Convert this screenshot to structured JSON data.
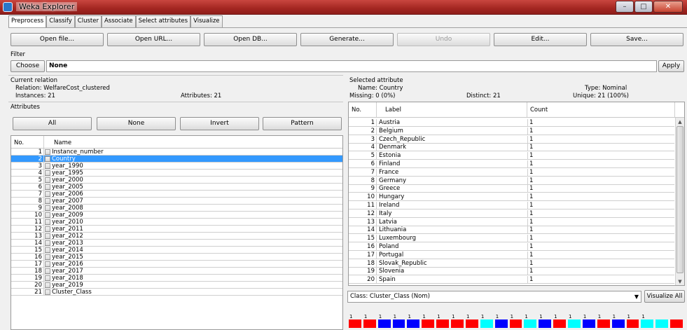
{
  "window": {
    "title": "Weka Explorer"
  },
  "tabs": [
    "Preprocess",
    "Classify",
    "Cluster",
    "Associate",
    "Select attributes",
    "Visualize"
  ],
  "toolbar": {
    "open_file": "Open file...",
    "open_url": "Open URL...",
    "open_db": "Open DB...",
    "generate": "Generate...",
    "undo": "Undo",
    "edit": "Edit...",
    "save": "Save..."
  },
  "filter": {
    "label": "Filter",
    "choose": "Choose",
    "value": "None",
    "apply": "Apply"
  },
  "current_relation": {
    "heading": "Current relation",
    "relation": "Relation: WelfareCost_clustered",
    "instances": "Instances: 21",
    "attributes": "Attributes: 21"
  },
  "attributes_panel": {
    "heading": "Attributes",
    "btn_all": "All",
    "btn_none": "None",
    "btn_invert": "Invert",
    "btn_pattern": "Pattern",
    "col_no": "No.",
    "col_name": "Name",
    "rows": [
      {
        "no": "1",
        "name": "Instance_number"
      },
      {
        "no": "2",
        "name": "Country"
      },
      {
        "no": "3",
        "name": "year_1990"
      },
      {
        "no": "4",
        "name": "year_1995"
      },
      {
        "no": "5",
        "name": "year_2000"
      },
      {
        "no": "6",
        "name": "year_2005"
      },
      {
        "no": "7",
        "name": "year_2006"
      },
      {
        "no": "8",
        "name": "year_2007"
      },
      {
        "no": "9",
        "name": "year_2008"
      },
      {
        "no": "10",
        "name": "year_2009"
      },
      {
        "no": "11",
        "name": "year_2010"
      },
      {
        "no": "12",
        "name": "year_2011"
      },
      {
        "no": "13",
        "name": "year_2012"
      },
      {
        "no": "14",
        "name": "year_2013"
      },
      {
        "no": "15",
        "name": "year_2014"
      },
      {
        "no": "16",
        "name": "year_2015"
      },
      {
        "no": "17",
        "name": "year_2016"
      },
      {
        "no": "18",
        "name": "year_2017"
      },
      {
        "no": "19",
        "name": "year_2018"
      },
      {
        "no": "20",
        "name": "year_2019"
      },
      {
        "no": "21",
        "name": "Cluster_Class"
      }
    ],
    "selected_index": 1
  },
  "selected_attribute": {
    "heading": "Selected attribute",
    "name": "Name: Country",
    "type": "Type: Nominal",
    "missing": "Missing: 0 (0%)",
    "distinct": "Distinct: 21",
    "unique": "Unique: 21 (100%)",
    "col_no": "No.",
    "col_label": "Label",
    "col_count": "Count",
    "rows": [
      {
        "no": "1",
        "label": "Austria",
        "count": "1"
      },
      {
        "no": "2",
        "label": "Belgium",
        "count": "1"
      },
      {
        "no": "3",
        "label": "Czech_Republic",
        "count": "1"
      },
      {
        "no": "4",
        "label": "Denmark",
        "count": "1"
      },
      {
        "no": "5",
        "label": "Estonia",
        "count": "1"
      },
      {
        "no": "6",
        "label": "Finland",
        "count": "1"
      },
      {
        "no": "7",
        "label": "France",
        "count": "1"
      },
      {
        "no": "8",
        "label": "Germany",
        "count": "1"
      },
      {
        "no": "9",
        "label": "Greece",
        "count": "1"
      },
      {
        "no": "10",
        "label": "Hungary",
        "count": "1"
      },
      {
        "no": "11",
        "label": "Ireland",
        "count": "1"
      },
      {
        "no": "12",
        "label": "Italy",
        "count": "1"
      },
      {
        "no": "13",
        "label": "Latvia",
        "count": "1"
      },
      {
        "no": "14",
        "label": "Lithuania",
        "count": "1"
      },
      {
        "no": "15",
        "label": "Luxembourg",
        "count": "1"
      },
      {
        "no": "16",
        "label": "Poland",
        "count": "1"
      },
      {
        "no": "17",
        "label": "Portugal",
        "count": "1"
      },
      {
        "no": "18",
        "label": "Slovak_Republic",
        "count": "1"
      },
      {
        "no": "19",
        "label": "Slovenia",
        "count": "1"
      },
      {
        "no": "20",
        "label": "Spain",
        "count": "1"
      }
    ]
  },
  "class_select": {
    "value": "Class: Cluster_Class (Nom)",
    "visualize_all": "Visualize All"
  },
  "histogram": {
    "counts": [
      "1",
      "1",
      "1",
      "1",
      "1",
      "1",
      "1",
      "1",
      "1",
      "1",
      "1",
      "1",
      "1",
      "1",
      "1",
      "1",
      "1",
      "1",
      "1",
      "1",
      "1"
    ],
    "colors": [
      "#ff0000",
      "#ff0000",
      "#0000ff",
      "#0000ff",
      "#0000ff",
      "#ff0000",
      "#ff0000",
      "#ff0000",
      "#ff0000",
      "#00ffff",
      "#0000ff",
      "#ff0000",
      "#00ffff",
      "#0000ff",
      "#ff0000",
      "#00ffff",
      "#0000ff",
      "#ff0000",
      "#0000ff",
      "#ff0000",
      "#00ffff",
      "#00ffff",
      "#ff0000"
    ]
  }
}
